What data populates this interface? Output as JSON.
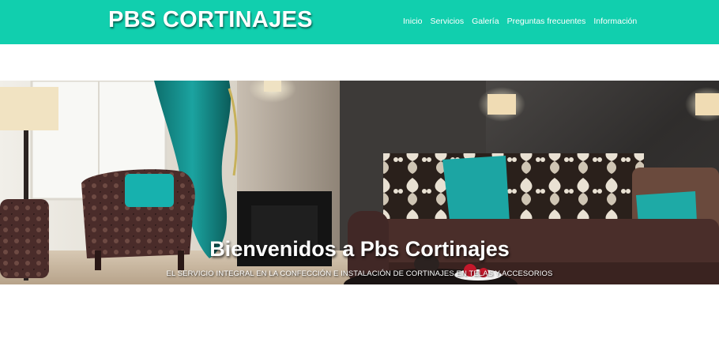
{
  "brand": {
    "name": "PBS CORTINAJES"
  },
  "nav": {
    "items": [
      {
        "label": "Inicio"
      },
      {
        "label": "Servicios"
      },
      {
        "label": "Galería"
      },
      {
        "label": "Preguntas frecuentes"
      },
      {
        "label": "Información"
      }
    ]
  },
  "hero": {
    "title": "Bienvenidos a Pbs Cortinajes",
    "subtitle": "EL SERVICIO INTEGRAL EN LA CONFECCIÓN E INSTALACIÓN DE CORTINAJES EN TELAS Y ACCESORIOS"
  },
  "colors": {
    "accent": "#11cfae",
    "teal_fabric": "#1ba3a0"
  }
}
